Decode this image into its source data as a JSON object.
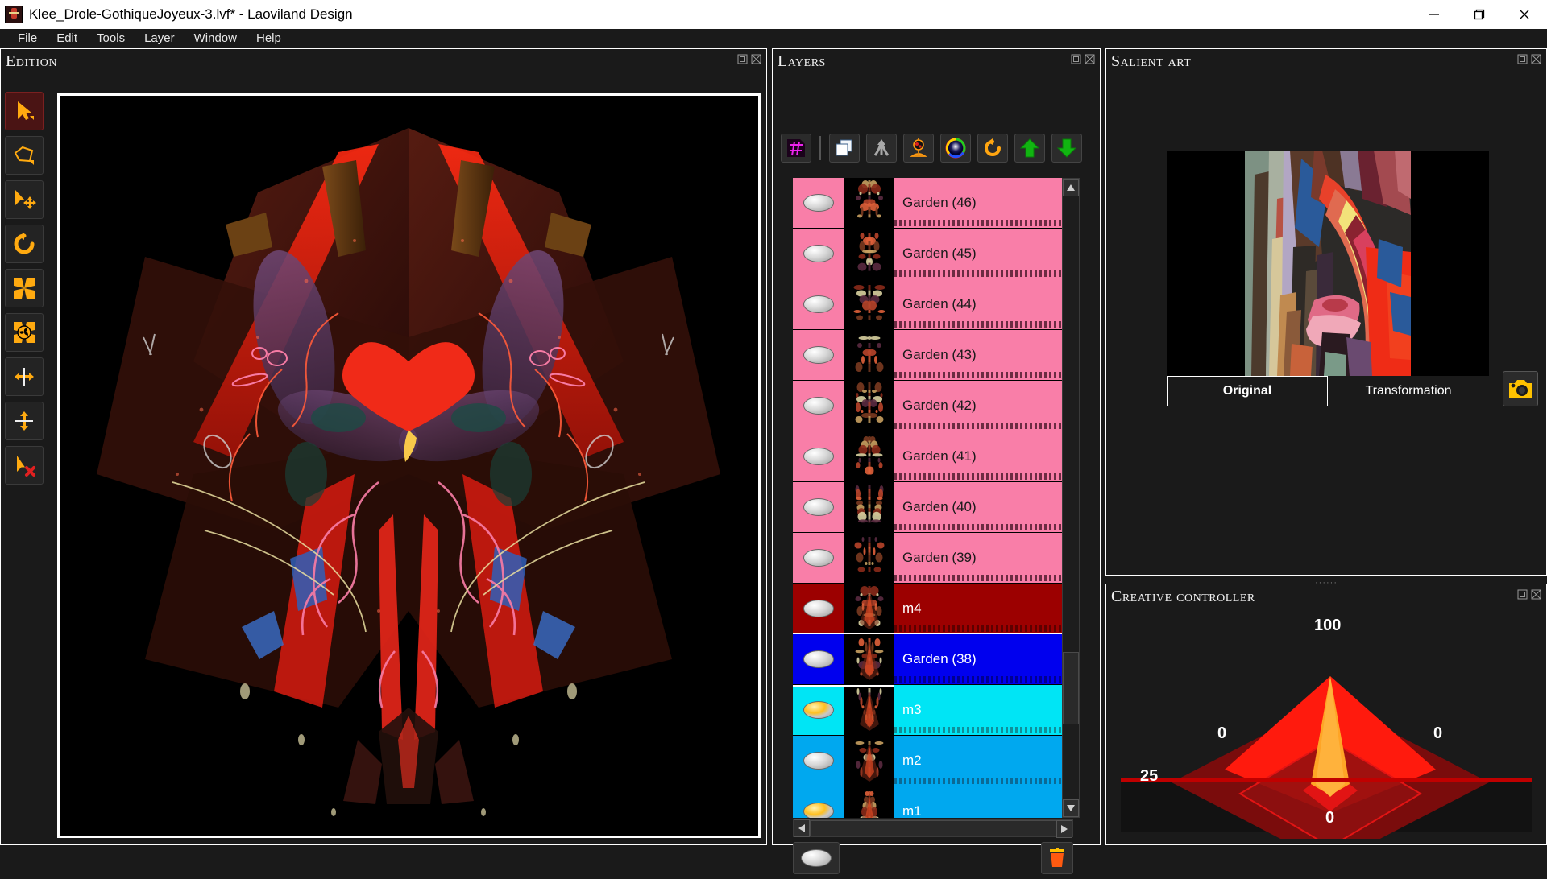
{
  "window": {
    "title": "Klee_Drole-GothiqueJoyeux-3.lvf* - Laoviland Design",
    "app_icon": "app-icon",
    "minimize": "—",
    "restore": "❐",
    "close": "✕"
  },
  "menubar": {
    "items": [
      {
        "mnemonic": "F",
        "rest": "ile"
      },
      {
        "mnemonic": "E",
        "rest": "dit"
      },
      {
        "mnemonic": "T",
        "rest": "ools"
      },
      {
        "mnemonic": "L",
        "rest": "ayer"
      },
      {
        "mnemonic": "W",
        "rest": "indow"
      },
      {
        "mnemonic": "H",
        "rest": "elp"
      }
    ]
  },
  "edition": {
    "title": "Edition",
    "tools": [
      {
        "name": "select-arrow-tool",
        "icon": "arrow-select-icon",
        "active": true
      },
      {
        "name": "polygon-lasso-tool",
        "icon": "polygon-lasso-icon",
        "active": false
      },
      {
        "name": "move-tool",
        "icon": "arrow-move-icon",
        "active": false
      },
      {
        "name": "rotate-tool",
        "icon": "rotate-icon",
        "active": false
      },
      {
        "name": "scale-tool",
        "icon": "scale-expand-icon",
        "active": false
      },
      {
        "name": "distort-tool",
        "icon": "distort-swirl-icon",
        "active": false
      },
      {
        "name": "flip-horizontal-tool",
        "icon": "flip-horizontal-icon",
        "active": false
      },
      {
        "name": "flip-vertical-tool",
        "icon": "flip-vertical-icon",
        "active": false
      },
      {
        "name": "deselect-tool",
        "icon": "arrow-delete-icon",
        "active": false
      }
    ]
  },
  "layers": {
    "title": "Layers",
    "toolbar": [
      {
        "name": "new-layer-button",
        "icon": "layer-hash-icon"
      },
      {
        "name": "duplicate-layer-button",
        "icon": "duplicate-layers-icon"
      },
      {
        "name": "merge-layers-button",
        "icon": "merge-arrows-icon"
      },
      {
        "name": "layer-properties-button",
        "icon": "lamp-icon"
      },
      {
        "name": "color-wheel-button",
        "icon": "color-wheel-icon"
      },
      {
        "name": "reset-layer-button",
        "icon": "undo-circle-icon"
      },
      {
        "name": "move-layer-up-button",
        "icon": "arrow-up-icon"
      },
      {
        "name": "move-layer-down-button",
        "icon": "arrow-down-icon"
      }
    ],
    "rows": [
      {
        "label": "Garden (46)",
        "bg": "#f97ea8",
        "fg": "#1a1a1a",
        "bar": "#6b2b42",
        "visible": false,
        "selected": false
      },
      {
        "label": "Garden (45)",
        "bg": "#f97ea8",
        "fg": "#1a1a1a",
        "bar": "#6b2b42",
        "visible": false,
        "selected": false
      },
      {
        "label": "Garden (44)",
        "bg": "#f97ea8",
        "fg": "#1a1a1a",
        "bar": "#6b2b42",
        "visible": false,
        "selected": false
      },
      {
        "label": "Garden (43)",
        "bg": "#f97ea8",
        "fg": "#1a1a1a",
        "bar": "#6b2b42",
        "visible": false,
        "selected": false
      },
      {
        "label": "Garden (42)",
        "bg": "#f97ea8",
        "fg": "#1a1a1a",
        "bar": "#6b2b42",
        "visible": false,
        "selected": false
      },
      {
        "label": "Garden (41)",
        "bg": "#f97ea8",
        "fg": "#1a1a1a",
        "bar": "#6b2b42",
        "visible": false,
        "selected": false
      },
      {
        "label": "Garden (40)",
        "bg": "#f97ea8",
        "fg": "#1a1a1a",
        "bar": "#6b2b42",
        "visible": false,
        "selected": false
      },
      {
        "label": "Garden (39)",
        "bg": "#f97ea8",
        "fg": "#1a1a1a",
        "bar": "#6b2b42",
        "visible": false,
        "selected": false
      },
      {
        "label": "m4",
        "bg": "#9c0000",
        "fg": "#ffffff",
        "bar": "#5c0000",
        "visible": false,
        "selected": false
      },
      {
        "label": "Garden (38)",
        "bg": "#0000ee",
        "fg": "#ffffff",
        "bar": "#000090",
        "visible": false,
        "selected": true
      },
      {
        "label": "m3",
        "bg": "#00e5f5",
        "fg": "#ffffff",
        "bar": "#0f8f99",
        "visible": true,
        "selected": false
      },
      {
        "label": "m2",
        "bg": "#00a8ef",
        "fg": "#ffffff",
        "bar": "#0b6a96",
        "visible": false,
        "selected": false
      },
      {
        "label": "m1",
        "bg": "#00a8ef",
        "fg": "#ffffff",
        "bar": "#0b6a96",
        "visible": true,
        "selected": false
      }
    ],
    "footer": [
      {
        "name": "toggle-all-visibility-button",
        "icon": "bulb-icon"
      },
      {
        "name": "delete-layer-button",
        "icon": "trash-icon"
      }
    ],
    "scroll_left": "◀",
    "scroll_right": "▶",
    "scroll_up": "▲",
    "scroll_down": "▼"
  },
  "salient": {
    "title": "Salient art",
    "tabs": [
      {
        "label": "Original",
        "selected": true
      },
      {
        "label": "Transformation",
        "selected": false
      }
    ],
    "camera_button": "camera-icon"
  },
  "creative": {
    "title": "Creative controller",
    "chart_data": {
      "type": "radar",
      "title": "Creative controller",
      "axes": [
        "top",
        "right",
        "bottom",
        "left"
      ],
      "labels": {
        "top": "100",
        "right": "0",
        "bottom": "0",
        "left": "0"
      },
      "values": {
        "top": 100,
        "right": 0,
        "bottom": 0,
        "left": 0
      },
      "baseline_label": "25",
      "baseline_value": 25,
      "colors": {
        "fill_outer": "#7a0c0c",
        "fill_bright": "#ff1a0d",
        "fill_accent": "#ffa526",
        "baseline": "#c00000"
      },
      "ylim": [
        0,
        100
      ],
      "grid": false,
      "legend": "none"
    }
  }
}
